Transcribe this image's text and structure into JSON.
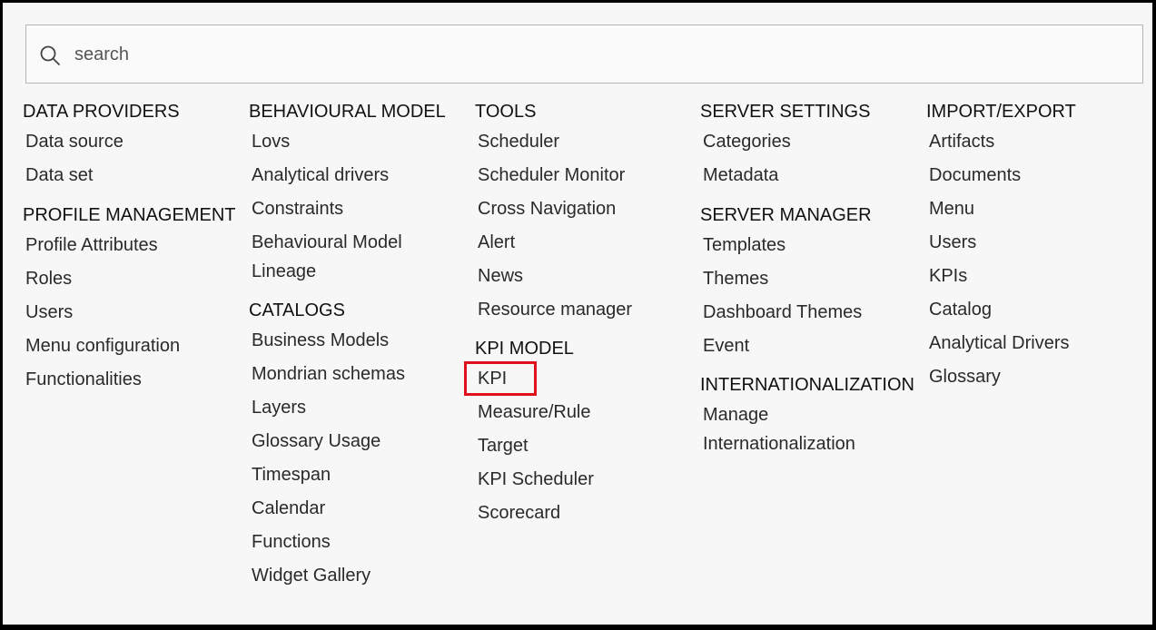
{
  "search": {
    "placeholder": "search"
  },
  "columns": [
    {
      "groups": [
        {
          "title": "DATA PROVIDERS",
          "items": [
            "Data source",
            "Data set"
          ]
        },
        {
          "title": "PROFILE MANAGEMENT",
          "items": [
            "Profile Attributes",
            "Roles",
            "Users",
            "Menu configuration",
            "Functionalities"
          ]
        }
      ]
    },
    {
      "groups": [
        {
          "title": "BEHAVIOURAL MODEL",
          "items": [
            "Lovs",
            "Analytical drivers",
            "Constraints",
            "Behavioural Model Lineage"
          ]
        },
        {
          "title": "CATALOGS",
          "items": [
            "Business Models",
            "Mondrian schemas",
            "Layers",
            "Glossary Usage",
            "Timespan",
            "Calendar",
            "Functions",
            "Widget Gallery"
          ]
        }
      ]
    },
    {
      "groups": [
        {
          "title": "TOOLS",
          "items": [
            "Scheduler",
            "Scheduler Monitor",
            "Cross Navigation",
            "Alert",
            "News",
            "Resource manager"
          ]
        },
        {
          "title": "KPI MODEL",
          "items": [
            "KPI",
            "Measure/Rule",
            "Target",
            "KPI Scheduler",
            "Scorecard"
          ]
        }
      ]
    },
    {
      "groups": [
        {
          "title": "SERVER SETTINGS",
          "items": [
            "Categories",
            "Metadata"
          ]
        },
        {
          "title": "SERVER MANAGER",
          "items": [
            "Templates",
            "Themes",
            "Dashboard Themes",
            "Event"
          ]
        },
        {
          "title": "INTERNATIONALIZATION",
          "items": [
            "Manage Internationalization"
          ]
        }
      ]
    },
    {
      "groups": [
        {
          "title": "IMPORT/EXPORT",
          "items": [
            "Artifacts",
            "Documents",
            "Menu",
            "Users",
            "KPIs",
            "Catalog",
            "Analytical Drivers",
            "Glossary"
          ]
        }
      ]
    }
  ],
  "highlight": {
    "color": "#e0111b",
    "item": "KPI"
  }
}
